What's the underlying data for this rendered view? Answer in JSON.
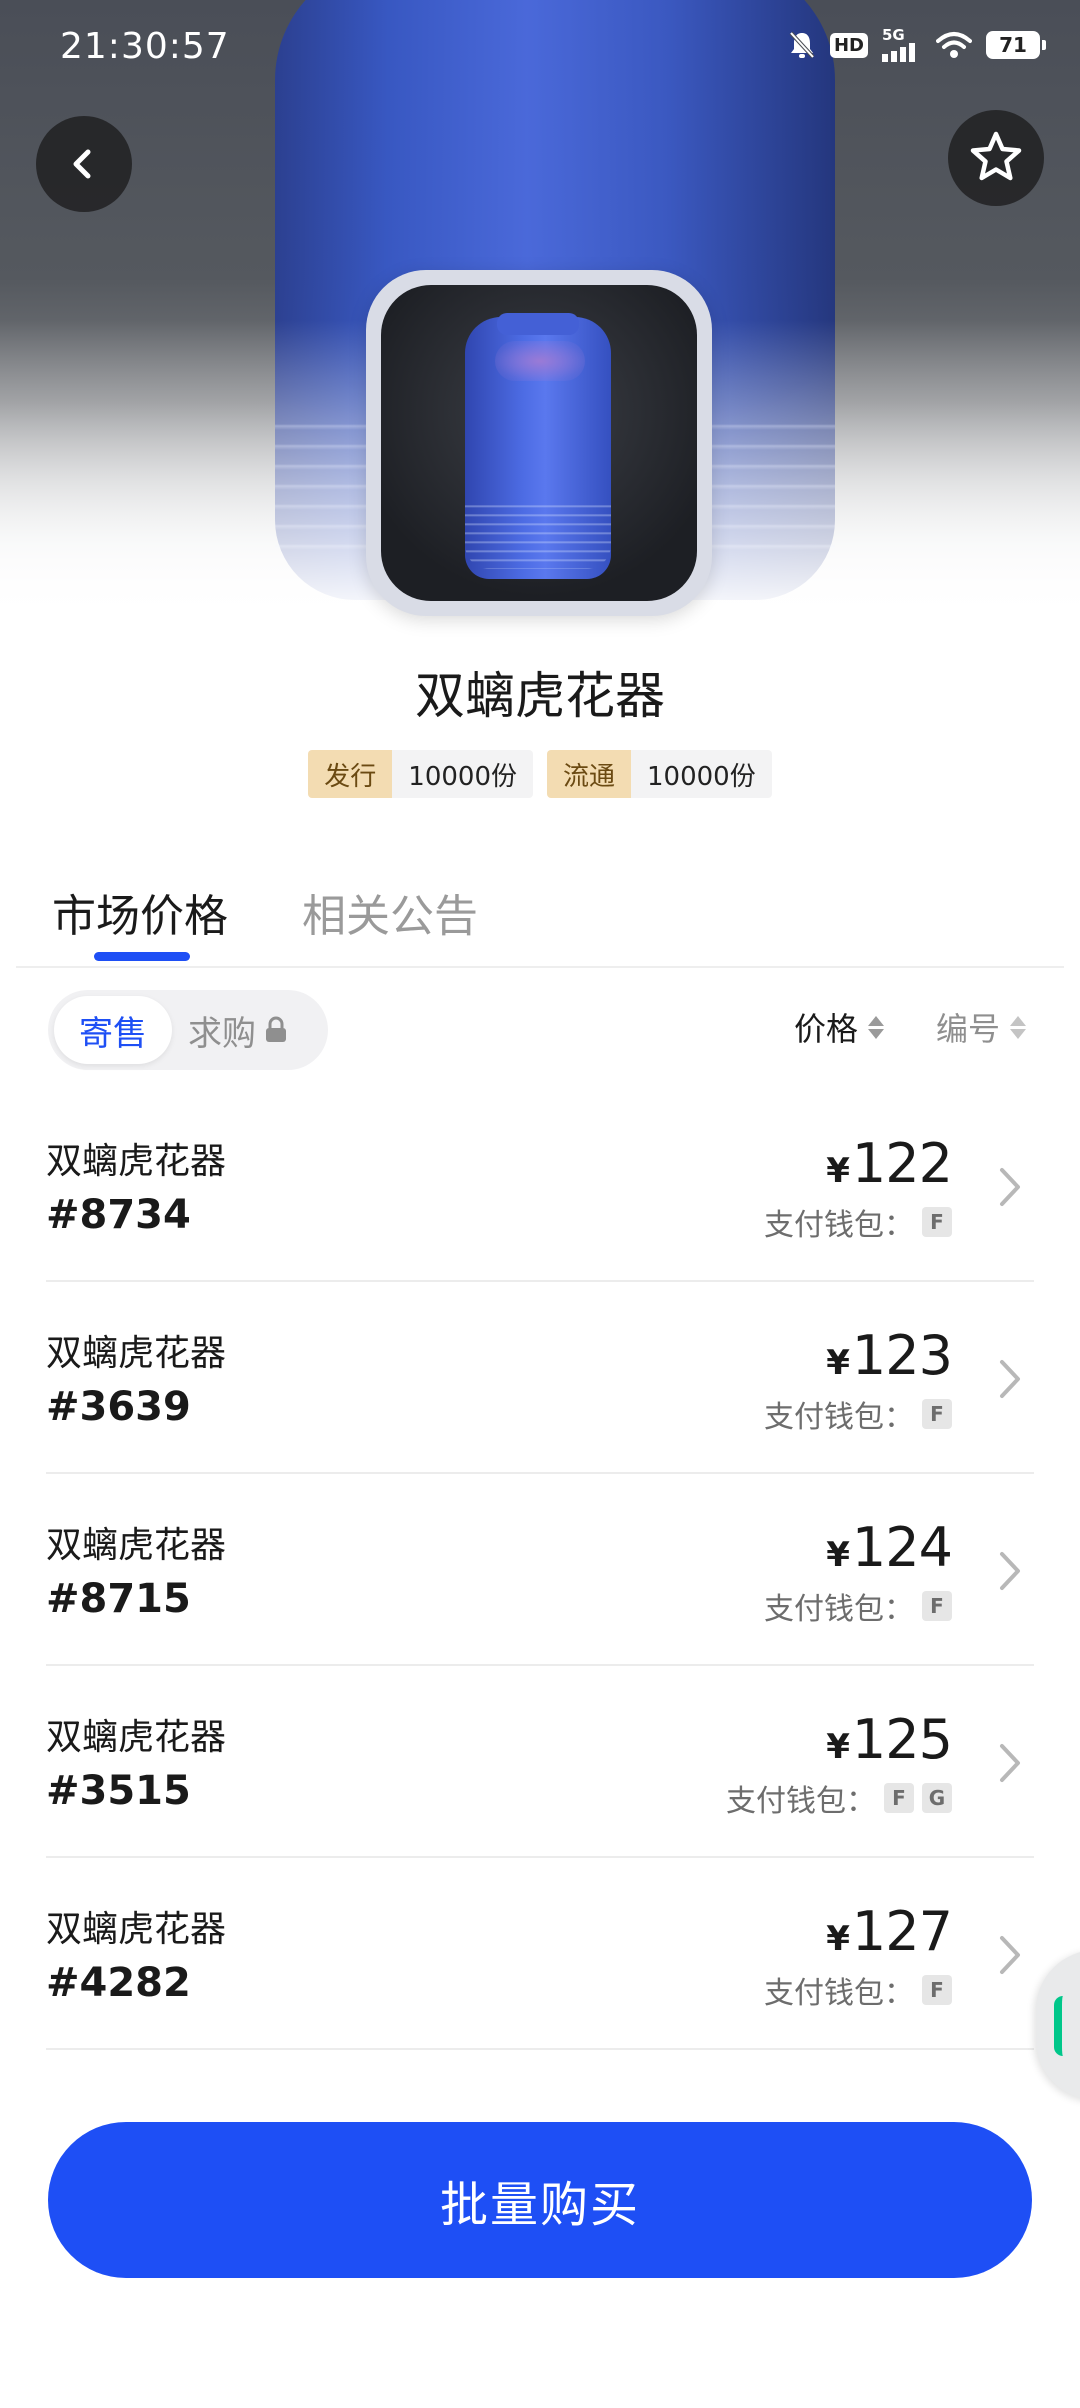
{
  "status_bar": {
    "time": "21:30:57",
    "network": "5G",
    "hd_label": "HD",
    "battery": "71"
  },
  "header": {
    "back_icon": "chevron-left-icon",
    "favorite_icon": "star-outline-icon"
  },
  "product": {
    "title": "双螭虎花器",
    "tags": [
      {
        "key": "发行",
        "value": "10000份"
      },
      {
        "key": "流通",
        "value": "10000份"
      }
    ]
  },
  "tabs": [
    {
      "label": "市场价格",
      "active": true
    },
    {
      "label": "相关公告",
      "active": false
    }
  ],
  "filter": {
    "segments": [
      {
        "label": "寄售",
        "active": true
      },
      {
        "label": "求购",
        "active": false,
        "locked": true
      }
    ],
    "sort": [
      {
        "label": "价格"
      },
      {
        "label": "编号"
      }
    ]
  },
  "listings": [
    {
      "name": "双螭虎花器",
      "number": "#8734",
      "currency": "¥",
      "price": "122",
      "wallet_label": "支付钱包：",
      "wallets": [
        "F"
      ]
    },
    {
      "name": "双螭虎花器",
      "number": "#3639",
      "currency": "¥",
      "price": "123",
      "wallet_label": "支付钱包：",
      "wallets": [
        "F"
      ]
    },
    {
      "name": "双螭虎花器",
      "number": "#8715",
      "currency": "¥",
      "price": "124",
      "wallet_label": "支付钱包：",
      "wallets": [
        "F"
      ]
    },
    {
      "name": "双螭虎花器",
      "number": "#3515",
      "currency": "¥",
      "price": "125",
      "wallet_label": "支付钱包：",
      "wallets": [
        "F",
        "G"
      ]
    },
    {
      "name": "双螭虎花器",
      "number": "#4282",
      "currency": "¥",
      "price": "127",
      "wallet_label": "支付钱包：",
      "wallets": [
        "F"
      ]
    }
  ],
  "bottom": {
    "buy_label": "批量购买"
  },
  "colors": {
    "accent": "#1e4ff5",
    "tag_key_bg": "#f3dcb2",
    "text_primary": "#1a1a1a",
    "text_secondary": "#8f8f8f"
  }
}
